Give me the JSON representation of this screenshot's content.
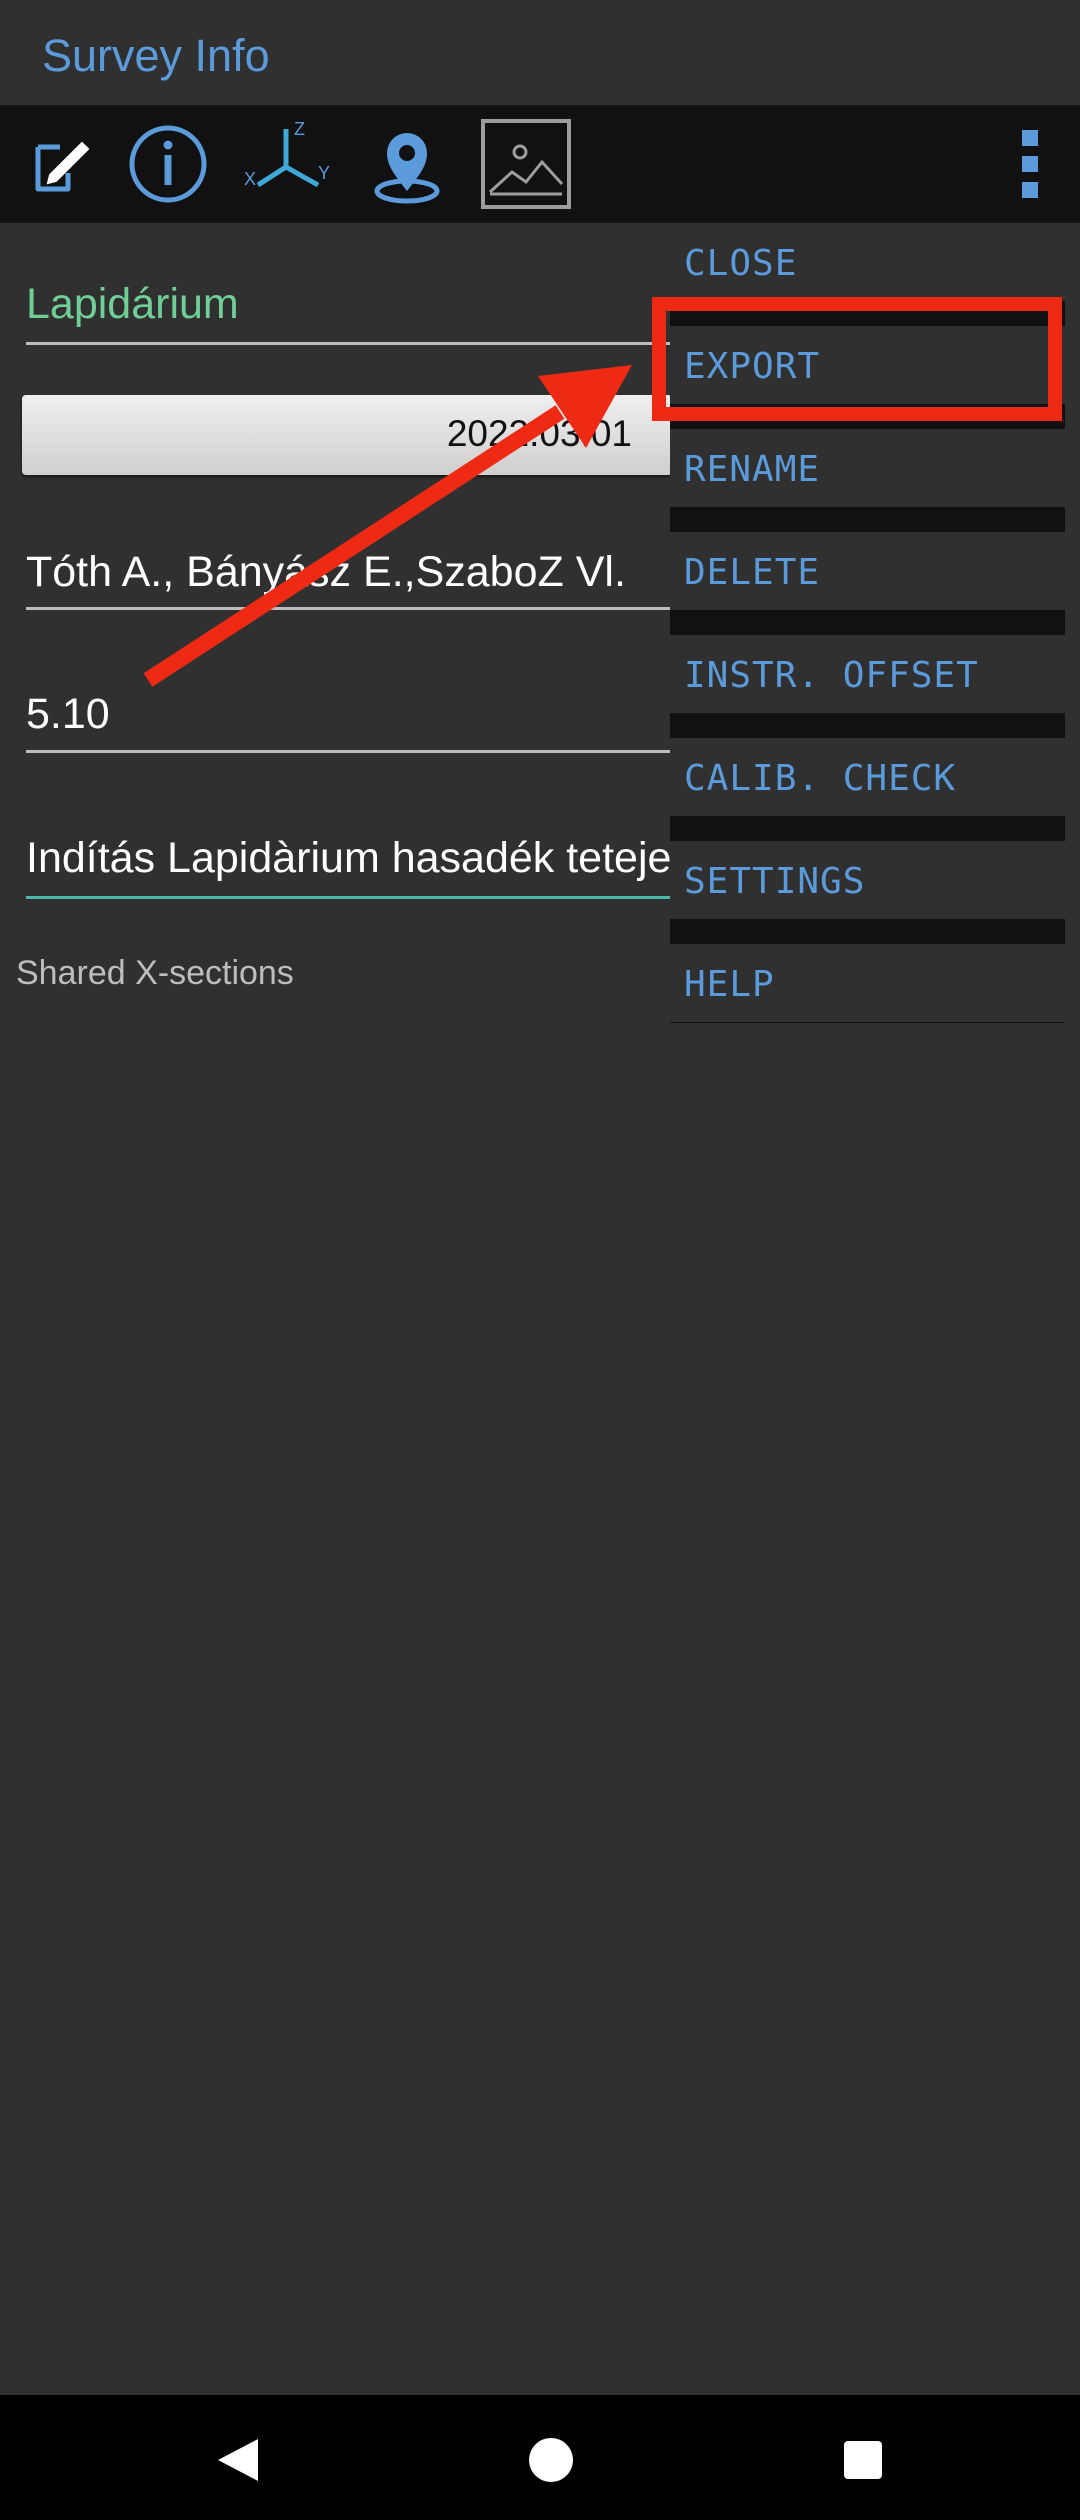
{
  "app": {
    "title": "Survey Info"
  },
  "toolbar": {
    "buttons": [
      {
        "name": "edit-note-icon"
      },
      {
        "name": "info-icon"
      },
      {
        "name": "axes-xyz-icon",
        "labels": [
          "X",
          "Y",
          "Z"
        ]
      },
      {
        "name": "location-pin-icon"
      },
      {
        "name": "image-icon"
      },
      {
        "name": "overflow-menu-icon"
      }
    ]
  },
  "form": {
    "name_value": "Lapidárium",
    "date_value": "2022.03.01",
    "team_value": "Tóth A., Bányász E.,SzaboZ Vl.",
    "declination_value": "5.10",
    "comment_value": "Indítás Lapidàrium hasadék teteje",
    "shared_label": "Shared X-sections"
  },
  "menu": {
    "items": [
      {
        "label": "CLOSE"
      },
      {
        "label": "EXPORT"
      },
      {
        "label": "RENAME"
      },
      {
        "label": "DELETE"
      },
      {
        "label": "INSTR. OFFSET"
      },
      {
        "label": "CALIB. CHECK"
      },
      {
        "label": "SETTINGS"
      },
      {
        "label": "HELP"
      }
    ]
  },
  "colors": {
    "accent": "#5b9bdc",
    "name_green": "#6fcf97",
    "annotation_red": "#ee2a14",
    "background": "#303030",
    "toolbar": "#111111"
  }
}
